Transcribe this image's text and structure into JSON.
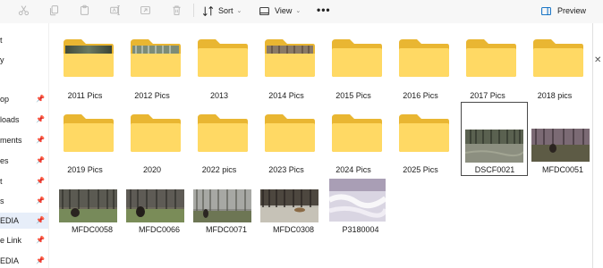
{
  "toolbar": {
    "sort_label": "Sort",
    "view_label": "View",
    "more_label": "•••",
    "preview_label": "Preview"
  },
  "sidebar": {
    "items": [
      {
        "label": "t",
        "pinned": false,
        "selected": false
      },
      {
        "label": "y",
        "pinned": false,
        "selected": false
      },
      {
        "label": "op",
        "pinned": true,
        "selected": false
      },
      {
        "label": "loads",
        "pinned": true,
        "selected": false
      },
      {
        "label": "ments",
        "pinned": true,
        "selected": false
      },
      {
        "label": "es",
        "pinned": true,
        "selected": false
      },
      {
        "label": "t",
        "pinned": true,
        "selected": false
      },
      {
        "label": "s",
        "pinned": true,
        "selected": false
      },
      {
        "label": "EDIA",
        "pinned": true,
        "selected": true
      },
      {
        "label": "e Link",
        "pinned": true,
        "selected": false
      },
      {
        "label": "EDIA",
        "pinned": true,
        "selected": false
      }
    ]
  },
  "folders": [
    {
      "name": "2011 Pics",
      "has_preview": true
    },
    {
      "name": "2012 Pics",
      "has_preview": true
    },
    {
      "name": "2013",
      "has_preview": false
    },
    {
      "name": "2014 Pics",
      "has_preview": true
    },
    {
      "name": "2015 Pics",
      "has_preview": false
    },
    {
      "name": "2016 Pics",
      "has_preview": false
    },
    {
      "name": "2017 Pics",
      "has_preview": false
    },
    {
      "name": "2018 pics",
      "has_preview": false
    },
    {
      "name": "2019 Pics",
      "has_preview": false
    },
    {
      "name": "2020",
      "has_preview": false
    },
    {
      "name": "2022 pics",
      "has_preview": false
    },
    {
      "name": "2023 Pics",
      "has_preview": false
    },
    {
      "name": "2024 Pics",
      "has_preview": false
    },
    {
      "name": "2025 Pics",
      "has_preview": false
    }
  ],
  "images": [
    {
      "name": "DSCF0021",
      "selected": true
    },
    {
      "name": "MFDC0051",
      "selected": false
    },
    {
      "name": "MFDC0058",
      "selected": false
    },
    {
      "name": "MFDC0066",
      "selected": false
    },
    {
      "name": "MFDC0071",
      "selected": false
    },
    {
      "name": "MFDC0308",
      "selected": false
    },
    {
      "name": "P3180004",
      "selected": false
    }
  ],
  "colors": {
    "folder_back": "#e9b632",
    "folder_front": "#ffd964",
    "selection_bg": "#e7eef9",
    "accent": "#0067c0"
  },
  "icons": {
    "cut": "scissors-icon",
    "copy": "copy-icon",
    "paste": "paste-icon",
    "rename": "rename-icon",
    "share": "share-icon",
    "delete": "trash-icon",
    "sort": "sort-icon",
    "view": "view-icon",
    "preview": "preview-pane-icon",
    "pin": "pin-icon"
  }
}
